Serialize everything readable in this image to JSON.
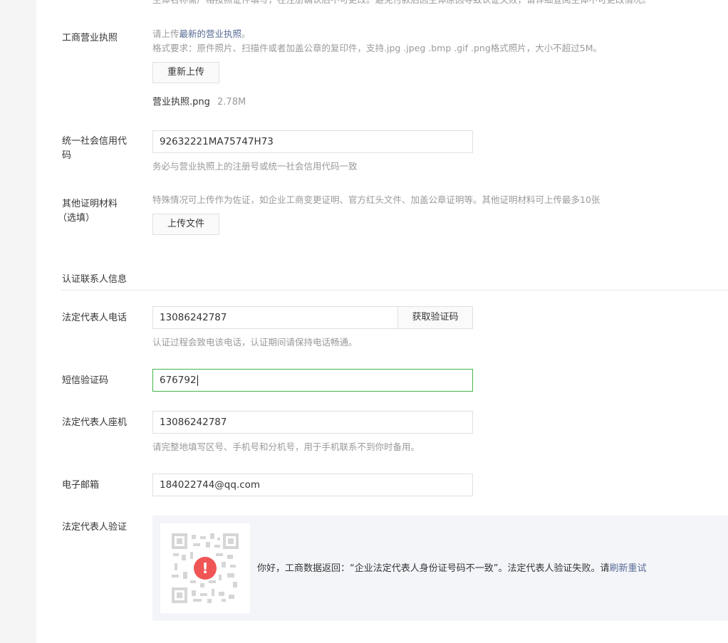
{
  "top_note": "主体名称需严格按照证件填写，在注册确认后不可更改。避免付款后因主体原因导致认证失败，请详细查阅主体不可更改情况。",
  "business_license": {
    "label": "工商营业执照",
    "tip_line1_prefix": "请上传",
    "tip_line1_link": "最新的营业执照",
    "tip_line1_suffix": "。",
    "tip_line2": "格式要求：原件照片、扫描件或者加盖公章的复印件，支持.jpg .jpeg .bmp .gif .png格式照片，大小不超过5M。",
    "reupload_button": "重新上传",
    "file_name": "营业执照.png",
    "file_size": "2.78M"
  },
  "credit_code": {
    "label_line1": "统一社会信用代",
    "label_line2": "码",
    "value": "92632221MA75747H73",
    "tip": "务必与营业执照上的注册号或统一社会信用代码一致"
  },
  "other_materials": {
    "label_line1": "其他证明材料",
    "label_line2": "（选填）",
    "tip": "特殊情况可上传作为佐证，如企业工商变更证明、官方红头文件、加盖公章证明等。其他证明材料可上传最多10张",
    "upload_button": "上传文件"
  },
  "section_title": "认证联系人信息",
  "legal_phone": {
    "label": "法定代表人电话",
    "value": "13086242787",
    "get_code_button": "获取验证码",
    "tip": "认证过程会致电该电话，认证期间请保持电话畅通。"
  },
  "sms_code": {
    "label": "短信验证码",
    "value": "676792"
  },
  "landline": {
    "label": "法定代表人座机",
    "value": "13086242787",
    "tip": "请完整地填写区号、手机号和分机号，用于手机联系不到你时备用。"
  },
  "email": {
    "label": "电子邮箱",
    "value": "184022744@qq.com"
  },
  "legal_verify": {
    "label": "法定代表人验证",
    "message": "你好，工商数据返回：“企业法定代表人身份证号码不一致”。法定代表人验证失败。请",
    "refresh_link": "刷新重试",
    "error_icon": "exclamation-icon"
  },
  "colors": {
    "accent_green": "#44b549",
    "link_blue": "#576b95",
    "error_red": "#f05555"
  }
}
